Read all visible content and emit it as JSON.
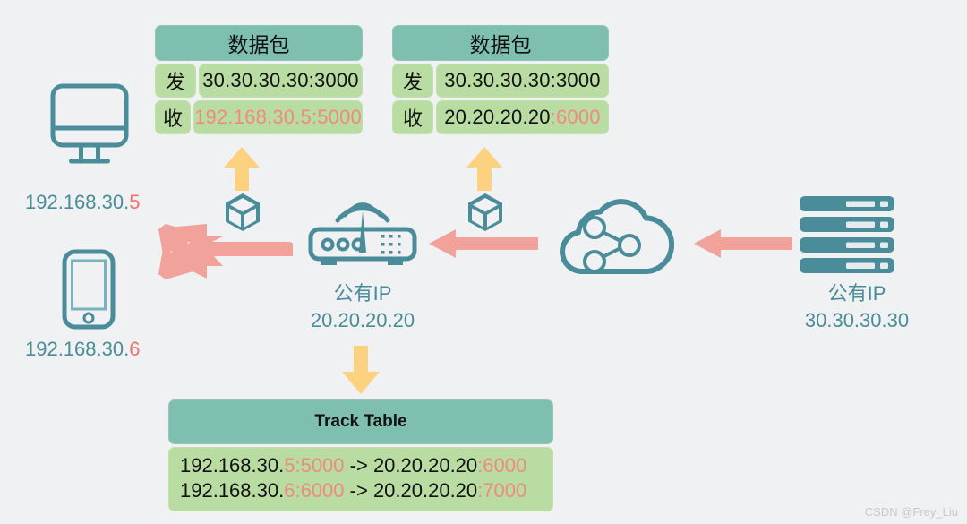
{
  "diagram": {
    "title": "NAT port forwarding / track table network diagram",
    "colors": {
      "background": "#eff1f2",
      "teal": "#4a8c99",
      "card_header": "#7fbfaf",
      "card_body": "#b9dca3",
      "red_text": "#f08a80",
      "arrow_yellow": "#fcd180",
      "arrow_salmon": "#f0a29b",
      "watermark": "#c7c9ca"
    }
  },
  "packets": [
    {
      "name": "packet-left",
      "title": "数据包",
      "rows": [
        {
          "key": "发",
          "value_black": "30.30.30.30:3000",
          "value_red": ""
        },
        {
          "key": "收",
          "value_black": "",
          "value_red": "192.168.30.5:5000"
        }
      ]
    },
    {
      "name": "packet-right",
      "title": "数据包",
      "rows": [
        {
          "key": "发",
          "value_black": "30.30.30.30:3000",
          "value_red": ""
        },
        {
          "key": "收",
          "value_black": "20.20.20.20",
          "value_red": ":6000"
        }
      ]
    }
  ],
  "track_table": {
    "title": "Track Table",
    "rows": [
      {
        "src_prefix": "192.168.30.",
        "src_host": "5:5000",
        "arrow": " -> ",
        "dst_prefix": "20.20.20.20",
        "dst_port": ":6000"
      },
      {
        "src_prefix": "192.168.30.",
        "src_host": "6:6000",
        "arrow": " -> ",
        "dst_prefix": "20.20.20.20",
        "dst_port": ":7000"
      }
    ]
  },
  "labels": {
    "desktop_ip_prefix": "192.168.30.",
    "desktop_ip_host": "5",
    "phone_ip_prefix": "192.168.30.",
    "phone_ip_host": "6",
    "router_title": "公有IP",
    "router_ip": "20.20.20.20",
    "server_title": "公有IP",
    "server_ip": "30.30.30.30"
  },
  "watermark": "CSDN @Frey_Liu",
  "icons": {
    "desktop": "desktop-monitor-icon",
    "phone": "mobile-phone-icon",
    "router": "wifi-router-icon",
    "cloud": "cloud-network-icon",
    "server": "server-rack-icon",
    "package_left": "package-cube-icon",
    "package_right": "package-cube-icon",
    "arrow_up_left": "arrow-up-icon",
    "arrow_up_right": "arrow-up-icon",
    "arrow_down": "arrow-down-icon",
    "arrow_fork": "forked-arrow-left-icon",
    "arrow_left_mid": "arrow-left-icon",
    "arrow_left_right": "arrow-left-icon"
  }
}
